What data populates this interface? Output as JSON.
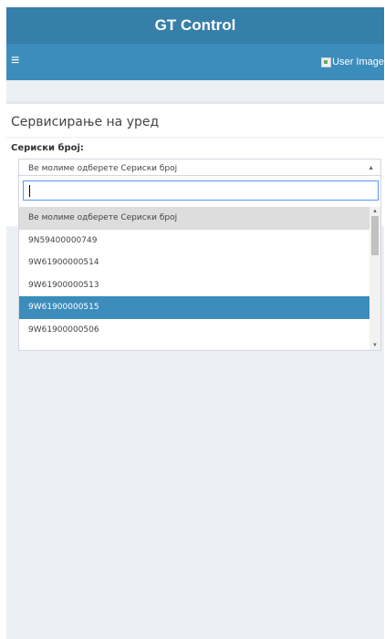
{
  "header": {
    "title": "GT Control"
  },
  "navbar": {
    "menu_icon": "≡",
    "user_image_alt": "User Image"
  },
  "box": {
    "title": "Сервисирање на уред",
    "field_label": "Сериски број:",
    "select_value": "Ве молиме одберете Сериски број"
  },
  "dropdown": {
    "search_value": "",
    "options": [
      "Ве молиме одберете Сериски број",
      "9N59400000749",
      "9W61900000514",
      "9W61900000513",
      "9W61900000515",
      "9W61900000506"
    ],
    "highlighted_option": "9W61900000515"
  },
  "colors": {
    "header_bg": "#367fa9",
    "navbar_bg": "#3c8dbc",
    "page_bg": "#ecf0f5",
    "highlight": "#3c8dbc"
  },
  "icons": [
    "hamburger-menu-icon",
    "user-image-icon",
    "chevron-up-icon",
    "scroll-up-icon",
    "scroll-down-icon"
  ]
}
